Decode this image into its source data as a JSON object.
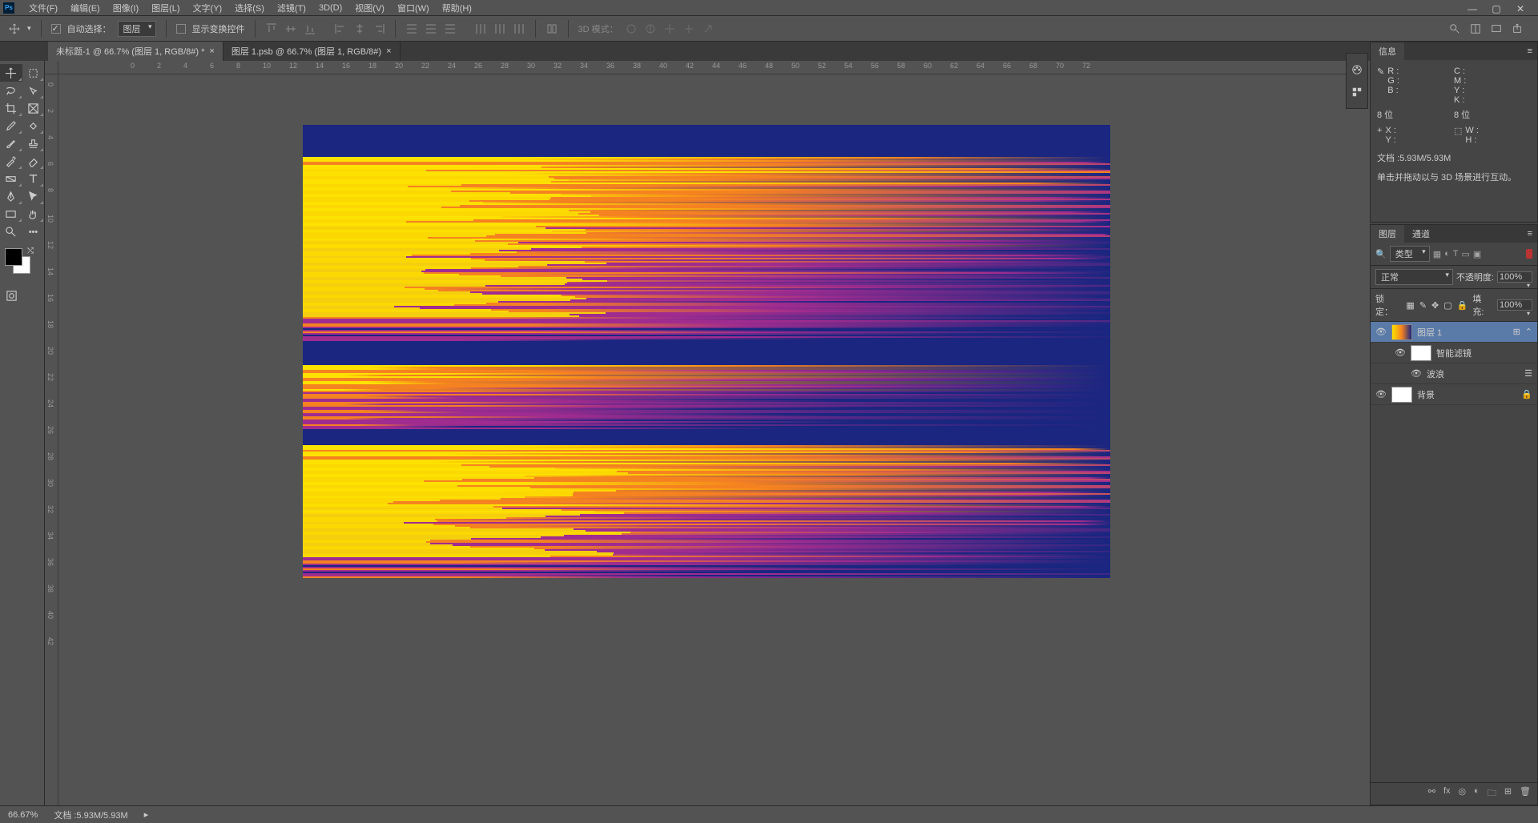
{
  "menu": {
    "items": [
      "文件(F)",
      "编辑(E)",
      "图像(I)",
      "图层(L)",
      "文字(Y)",
      "选择(S)",
      "滤镜(T)",
      "3D(D)",
      "视图(V)",
      "窗口(W)",
      "帮助(H)"
    ]
  },
  "options": {
    "auto_select": "自动选择：",
    "layer_group": "图层",
    "show_transform": "显示变换控件",
    "mode_3d": "3D 模式："
  },
  "tabs": [
    {
      "label": "未标题-1 @ 66.7% (图层 1, RGB/8#) *",
      "active": true
    },
    {
      "label": "图层 1.psb @ 66.7% (图层 1, RGB/8#)",
      "active": false
    }
  ],
  "info_panel": {
    "title": "信息",
    "rgb": {
      "R": "R :",
      "G": "G :",
      "B": "B :"
    },
    "cmyk": {
      "C": "C :",
      "M": "M :",
      "Y": "Y :",
      "K": "K :"
    },
    "bit": "8 位",
    "bit2": "8 位",
    "xy": {
      "X": "X :",
      "Y": "Y :"
    },
    "wh": {
      "W": "W :",
      "H": "H :"
    },
    "doc": "文档 :5.93M/5.93M",
    "hint": "单击并拖动以与 3D 场景进行互动。"
  },
  "layers_panel": {
    "tab1": "图层",
    "tab2": "通道",
    "kind": "类型",
    "blend": "正常",
    "opacity_label": "不透明度:",
    "opacity": "100%",
    "lock_label": "锁定：",
    "fill_label": "填充:",
    "fill": "100%",
    "items": [
      {
        "name": "图层 1",
        "selected": true,
        "thumb": "img"
      },
      {
        "name": "智能滤镜",
        "indented": true,
        "thumb": "white"
      },
      {
        "name": "波浪",
        "indented": true,
        "sub": true
      },
      {
        "name": "背景",
        "thumb": "white",
        "locked": true
      }
    ]
  },
  "status": {
    "zoom": "66.67%",
    "doc": "文档 :5.93M/5.93M"
  },
  "ruler_h": [
    0,
    2,
    4,
    6,
    8,
    10,
    12,
    14,
    16,
    18,
    20,
    22,
    24,
    26,
    28,
    30,
    32,
    34,
    36,
    38,
    40,
    42,
    44,
    46,
    48,
    50,
    52,
    54,
    56,
    58,
    60,
    62,
    64,
    66,
    68,
    70,
    72
  ],
  "ruler_v": [
    0,
    2,
    4,
    6,
    8,
    10,
    12,
    14,
    16,
    18,
    20,
    22,
    24,
    26,
    28,
    30,
    32,
    34,
    36,
    38,
    40,
    42
  ]
}
